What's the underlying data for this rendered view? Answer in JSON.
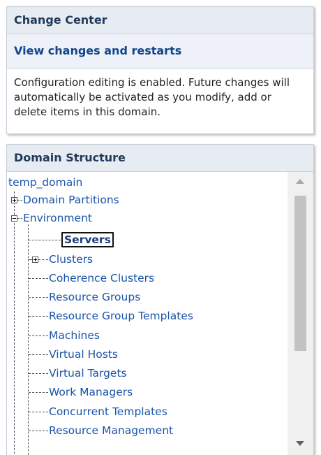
{
  "change_center": {
    "title": "Change Center",
    "link": "View changes and restarts",
    "message": "Configuration editing is enabled. Future changes will automatically be activated as you modify, add or delete items in this domain."
  },
  "domain_structure": {
    "title": "Domain Structure",
    "root": "temp_domain",
    "items": {
      "domain_partitions": "Domain Partitions",
      "environment": "Environment",
      "servers": "Servers",
      "clusters": "Clusters",
      "coherence_clusters": "Coherence Clusters",
      "resource_groups": "Resource Groups",
      "resource_group_templates": "Resource Group Templates",
      "machines": "Machines",
      "virtual_hosts": "Virtual Hosts",
      "virtual_targets": "Virtual Targets",
      "work_managers": "Work Managers",
      "concurrent_templates": "Concurrent Templates",
      "resource_management": "Resource Management"
    }
  }
}
